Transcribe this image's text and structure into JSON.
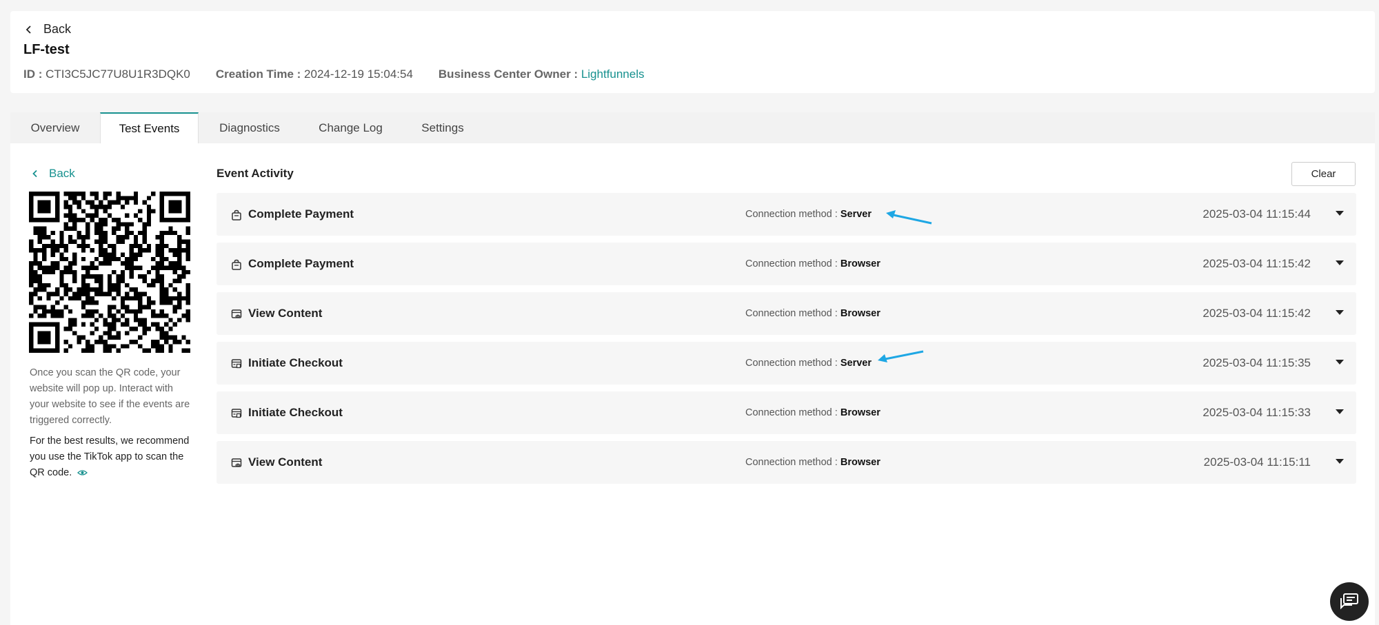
{
  "header": {
    "back_label": "Back",
    "title": "LF-test",
    "id_label": "ID :",
    "id_value": "CTI3C5JC77U8U1R3DQK0",
    "creation_label": "Creation Time :",
    "creation_value": "2024-12-19 15:04:54",
    "owner_label": "Business Center Owner :",
    "owner_value": "Lightfunnels"
  },
  "tabs": [
    {
      "label": "Overview",
      "active": false
    },
    {
      "label": "Test Events",
      "active": true
    },
    {
      "label": "Diagnostics",
      "active": false
    },
    {
      "label": "Change Log",
      "active": false
    },
    {
      "label": "Settings",
      "active": false
    }
  ],
  "left": {
    "back_label": "Back",
    "instructions": "Once you scan the QR code, your website will pop up. Interact with your website to see if the events are triggered correctly.",
    "recommendation": "For the best results, we recommend you use the TikTok app to scan the QR code."
  },
  "activity": {
    "title": "Event Activity",
    "clear_label": "Clear",
    "connection_label": "Connection method :",
    "events": [
      {
        "name": "Complete Payment",
        "icon": "bag-icon",
        "method": "Server",
        "time": "2025-03-04 11:15:44"
      },
      {
        "name": "Complete Payment",
        "icon": "bag-icon",
        "method": "Browser",
        "time": "2025-03-04 11:15:42"
      },
      {
        "name": "View Content",
        "icon": "view-content-icon",
        "method": "Browser",
        "time": "2025-03-04 11:15:42"
      },
      {
        "name": "Initiate Checkout",
        "icon": "checkout-icon",
        "method": "Server",
        "time": "2025-03-04 11:15:35"
      },
      {
        "name": "Initiate Checkout",
        "icon": "checkout-icon",
        "method": "Browser",
        "time": "2025-03-04 11:15:33"
      },
      {
        "name": "View Content",
        "icon": "view-content-icon",
        "method": "Browser",
        "time": "2025-03-04 11:15:11"
      }
    ]
  },
  "colors": {
    "accent": "#17918f",
    "annotation_arrow": "#1ea7e4",
    "chat_button": "#222222"
  }
}
